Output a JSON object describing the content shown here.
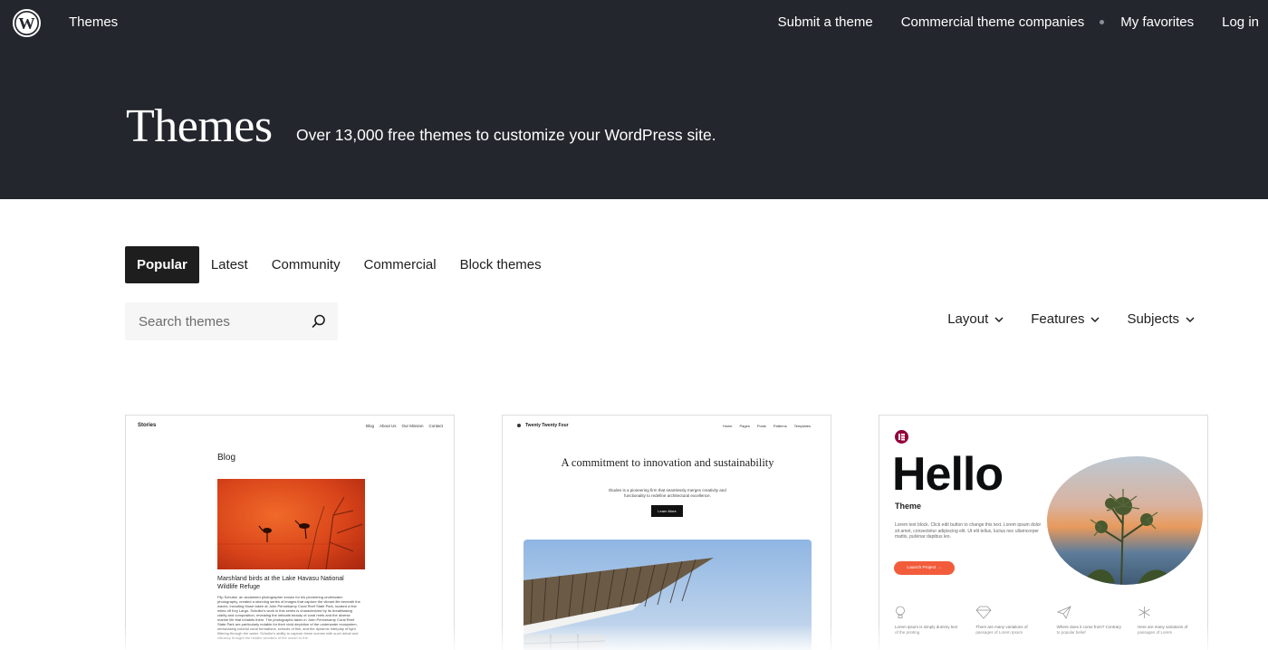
{
  "header": {
    "logo_icon": "wordpress-logo-icon",
    "brand": "Themes",
    "nav": [
      "Submit a theme",
      "Commercial theme companies",
      "My favorites",
      "Log in"
    ]
  },
  "hero": {
    "title": "Themes",
    "subtitle": "Over 13,000 free themes to customize your WordPress site."
  },
  "tabs": {
    "items": [
      "Popular",
      "Latest",
      "Community",
      "Commercial",
      "Block themes"
    ],
    "active": "Popular"
  },
  "search": {
    "placeholder": "Search themes",
    "value": "",
    "icon": "search-icon"
  },
  "filters": [
    "Layout",
    "Features",
    "Subjects"
  ],
  "colors": {
    "hero_bg": "#23262d",
    "active_tab_bg": "#1e1e1e",
    "search_bg": "#f6f6f6",
    "hello_accent": "#f25c3b"
  },
  "cards": [
    {
      "site_title": "Stories",
      "nav": [
        "Blog",
        "About Us",
        "Our Mission",
        "Contact"
      ],
      "heading": "Blog",
      "post_title": "Marshland birds at the Lake Havasu National Wildlife Refuge",
      "post_body": "Flip Schulke, an acclaimed photographer known for his pioneering underwater photography, created a stunning series of images that capture the vibrant life beneath the waves, including those taken at John Pennekamp Coral Reef State Park, located a few miles off Key Largo. Schulke's work in this series is characterized by its breathtaking clarity and composition, revealing the intricate beauty of coral reefs and the diverse marine life that inhabits them. The photographs taken in John Pennekamp Coral Reef State Park are particularly notable for their vivid depiction of the underwater ecosystem, showcasing colorful coral formations, schools of fish, and the dynamic interplay of light filtering through the water. Schulke's ability to capture these scenes with such detail and vibrancy brought the hidden wonders of the ocean to the"
    },
    {
      "site_title": "Twenty Twenty Four",
      "nav": [
        "Home",
        "Pages",
        "Posts",
        "Patterns",
        "Templates"
      ],
      "heading": "A commitment to innovation and sustainability",
      "body": "Études is a pioneering firm that seamlessly merges creativity and functionality to redefine architectural excellence.",
      "button": "Learn More"
    },
    {
      "logo_icon": "elementor-logo-icon",
      "heading": "Hello",
      "subheading": "Theme",
      "body": "Lorem text block. Click edit button to change this text. Lorem ipsum dolor sit amet, consectetur adipiscing elit. Ut elit tellus, luctus nec ullamcorper mattis, pulvinar dapibus leo.",
      "button": "Launch Project →",
      "features": [
        {
          "icon": "lightbulb-icon",
          "text": "Lorem ipsum is simply dummy text of the printing"
        },
        {
          "icon": "diamond-icon",
          "text": "There are many variations of passages of Lorem Ipsum"
        },
        {
          "icon": "paper-plane-icon",
          "text": "Where does it come from? Contrary to popular belief"
        },
        {
          "icon": "snowflake-icon",
          "text": "Here are many variations of passages of Lorem"
        }
      ]
    }
  ]
}
